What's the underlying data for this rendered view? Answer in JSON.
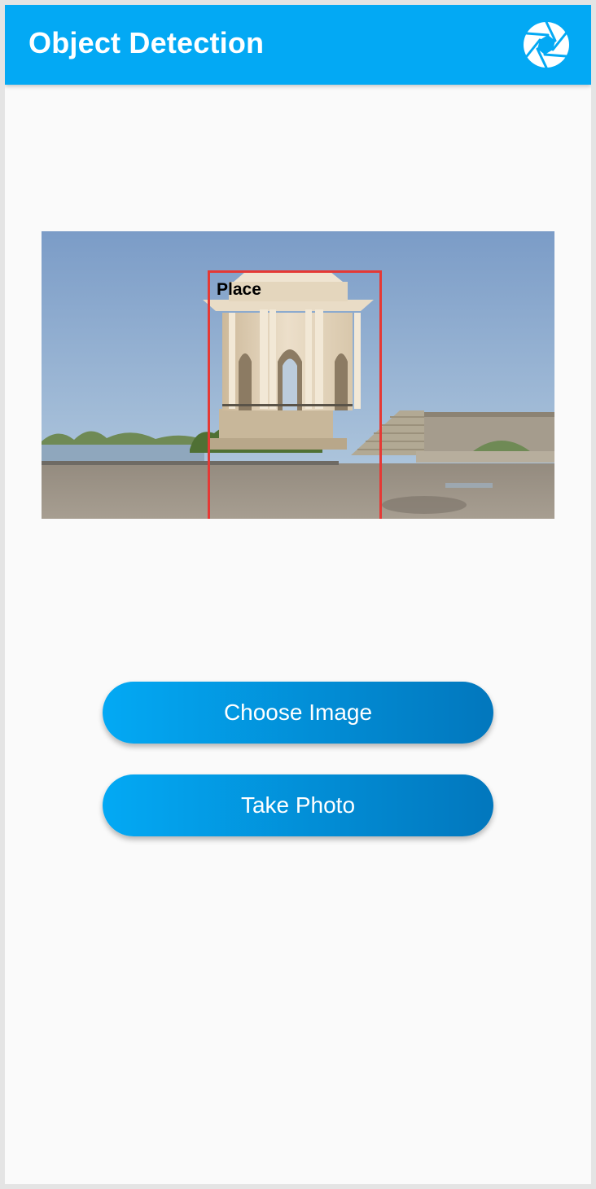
{
  "app_bar": {
    "title": "Object Detection",
    "action_icon": "camera-aperture-icon",
    "background_color": "#03a9f4"
  },
  "result": {
    "image_subject": "photo-of-domed-water-tower-pavilion",
    "detection": {
      "label": "Place",
      "box_color": "#e53935"
    }
  },
  "actions": {
    "choose_image_label": "Choose Image",
    "take_photo_label": "Take Photo",
    "gradient_start": "#03a9f4",
    "gradient_end": "#0277bd"
  }
}
